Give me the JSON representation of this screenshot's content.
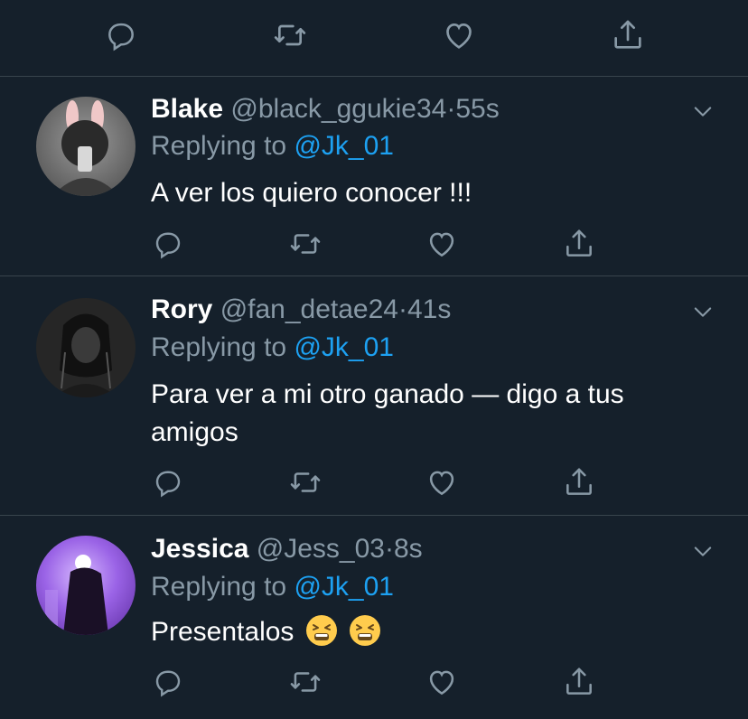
{
  "top_actions": {
    "icons": [
      "reply-icon",
      "retweet-icon",
      "like-icon",
      "share-icon"
    ]
  },
  "tweets": [
    {
      "name": "Blake",
      "handle": "@black_ggukie34",
      "separator": "·",
      "time": "55s",
      "replying_prefix": "Replying to ",
      "replying_to": "@Jk_01",
      "text": "A ver los quiero conocer !!!"
    },
    {
      "name": "Rory",
      "handle": "@fan_detae24",
      "separator": "·",
      "time": "41s",
      "replying_prefix": "Replying to ",
      "replying_to": "@Jk_01",
      "text": "Para ver a mi otro ganado — digo a tus amigos"
    },
    {
      "name": "Jessica",
      "handle": "@Jess_03",
      "separator": "·",
      "time": "8s",
      "replying_prefix": "Replying to ",
      "replying_to": "@Jk_01",
      "text": "Presentalos"
    }
  ],
  "colors": {
    "background": "#15202b",
    "divider": "#38444d",
    "secondary_text": "#8899a6",
    "link": "#1da1f2"
  }
}
